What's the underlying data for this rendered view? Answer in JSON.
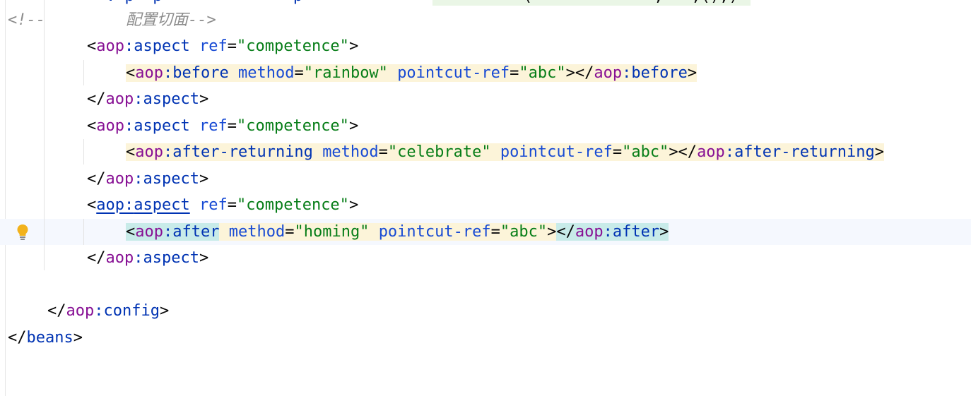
{
  "editor": {
    "top_fragment": {
      "left_part": ". p  p              p",
      "right_part": "(             ,   ,(),)"
    },
    "lines": [
      {
        "comment_open": "<!--",
        "comment_text": "配置切面",
        "comment_close": "-->"
      },
      {
        "open": "<",
        "ns": "aop",
        "colon": ":",
        "tag": "aspect",
        "attr": "ref",
        "eq": "=",
        "value": "\"competence\"",
        "close": ">"
      },
      {
        "open": "<",
        "ns": "aop",
        "colon": ":",
        "tag": "before",
        "attr1": "method",
        "eq1": "=",
        "value1": "\"rainbow\"",
        "attr2": "pointcut-ref",
        "eq2": "=",
        "value2": "\"abc\"",
        "mid": "></",
        "end_ns": "aop",
        "end_colon": ":",
        "end_tag": "before",
        "close": ">"
      },
      {
        "open": "</",
        "ns": "aop",
        "colon": ":",
        "tag": "aspect",
        "close": ">"
      },
      {
        "open": "<",
        "ns": "aop",
        "colon": ":",
        "tag": "aspect",
        "attr": "ref",
        "eq": "=",
        "value": "\"competence\"",
        "close": ">"
      },
      {
        "open": "<",
        "ns": "aop",
        "colon": ":",
        "tag": "after-returning",
        "attr1": "method",
        "eq1": "=",
        "value1": "\"celebrate\"",
        "attr2": "pointcut-ref",
        "eq2": "=",
        "value2": "\"abc\"",
        "mid": "></",
        "end_ns": "aop",
        "end_colon": ":",
        "end_tag": "after-returning",
        "close": ">"
      },
      {
        "open": "</",
        "ns": "aop",
        "colon": ":",
        "tag": "aspect",
        "close": ">"
      },
      {
        "open": "<",
        "ns": "aop",
        "colon": ":",
        "tag": "aspect",
        "attr": "ref",
        "eq": "=",
        "value": "\"competence\"",
        "close": ">"
      },
      {
        "open": "<",
        "ns": "aop",
        "colon": ":",
        "tag": "after",
        "attr1": "method",
        "eq1": "=",
        "value1": "\"homing\"",
        "attr2": "pointcut-ref",
        "eq2": "=",
        "value2": "\"abc\"",
        "mid_open": ">",
        "mid_close": "</",
        "end_ns": "aop",
        "end_colon": ":",
        "end_tag": "after",
        "close": ">"
      },
      {
        "open": "</",
        "ns": "aop",
        "colon": ":",
        "tag": "aspect",
        "close": ">"
      },
      {
        "open": "</",
        "ns": "aop",
        "colon": ":",
        "tag": "config",
        "close": ">"
      },
      {
        "open": "</",
        "tag": "beans",
        "close": ">"
      }
    ],
    "gutter": {
      "intention_icon": "lightbulb-icon"
    },
    "colors": {
      "background": "#ffffff",
      "bracket": "#080808",
      "namespace": "#871094",
      "tag": "#0033b3",
      "attribute": "#174ad4",
      "value": "#067d17",
      "comment": "#8c8c8c",
      "highlight": "#fcf4d9",
      "tag_match": "#c8ebe9",
      "current_line": "#f5f8fe"
    }
  }
}
